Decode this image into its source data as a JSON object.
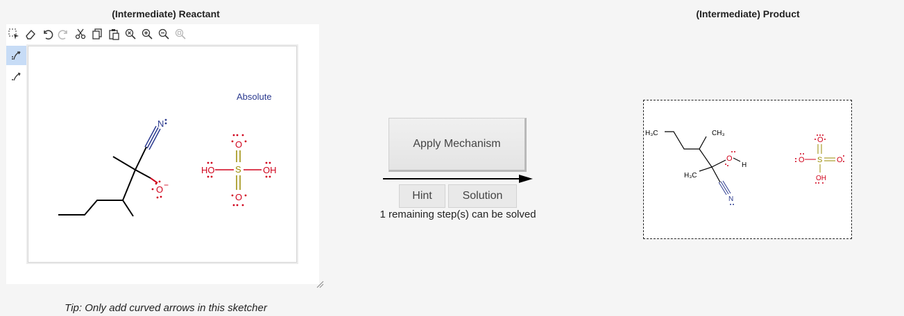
{
  "reactant": {
    "title": "(Intermediate) Reactant",
    "absolute_label": "Absolute",
    "tip": "Tip: Only add curved arrows in this sketcher",
    "toolbar_icons": [
      "select-icon",
      "eraser-icon",
      "undo-icon",
      "redo-icon",
      "cut-icon",
      "copy-icon",
      "paste-icon",
      "zoom-reset-icon",
      "zoom-in-icon",
      "zoom-out-icon",
      "zoom-fit-icon"
    ],
    "sidebar_icons": [
      "curved-arrow-pair-icon",
      "curved-arrow-single-icon"
    ],
    "atoms": {
      "nitrogen": "N",
      "oxygen": "O",
      "charge": "−",
      "sulfur": "S",
      "sulfate_oxygen": "O",
      "hydroxyl_left": "HO",
      "hydroxyl_right": "OH"
    }
  },
  "mechanism": {
    "apply_label": "Apply Mechanism",
    "hint_label": "Hint",
    "solution_label": "Solution",
    "remaining_text": "1 remaining step(s) can be solved"
  },
  "product": {
    "title": "(Intermediate) Product",
    "atoms": {
      "ch3_top_left": "H₃C",
      "ch3_top": "CH₃",
      "ch3_mid": "H₃C",
      "oxygen": "O",
      "hydrogen": "H",
      "nitrogen": "N",
      "sulfate_o_top": "O",
      "sulfate_o_left": "O",
      "sulfate_s": "S",
      "sulfate_o_right": "O",
      "sulfate_oh": "OH"
    }
  },
  "colors": {
    "nitrogen": "#2b3a8f",
    "oxygen": "#d0021b",
    "sulfur": "#9a8a00",
    "active_tool": "#c7dcf6"
  }
}
